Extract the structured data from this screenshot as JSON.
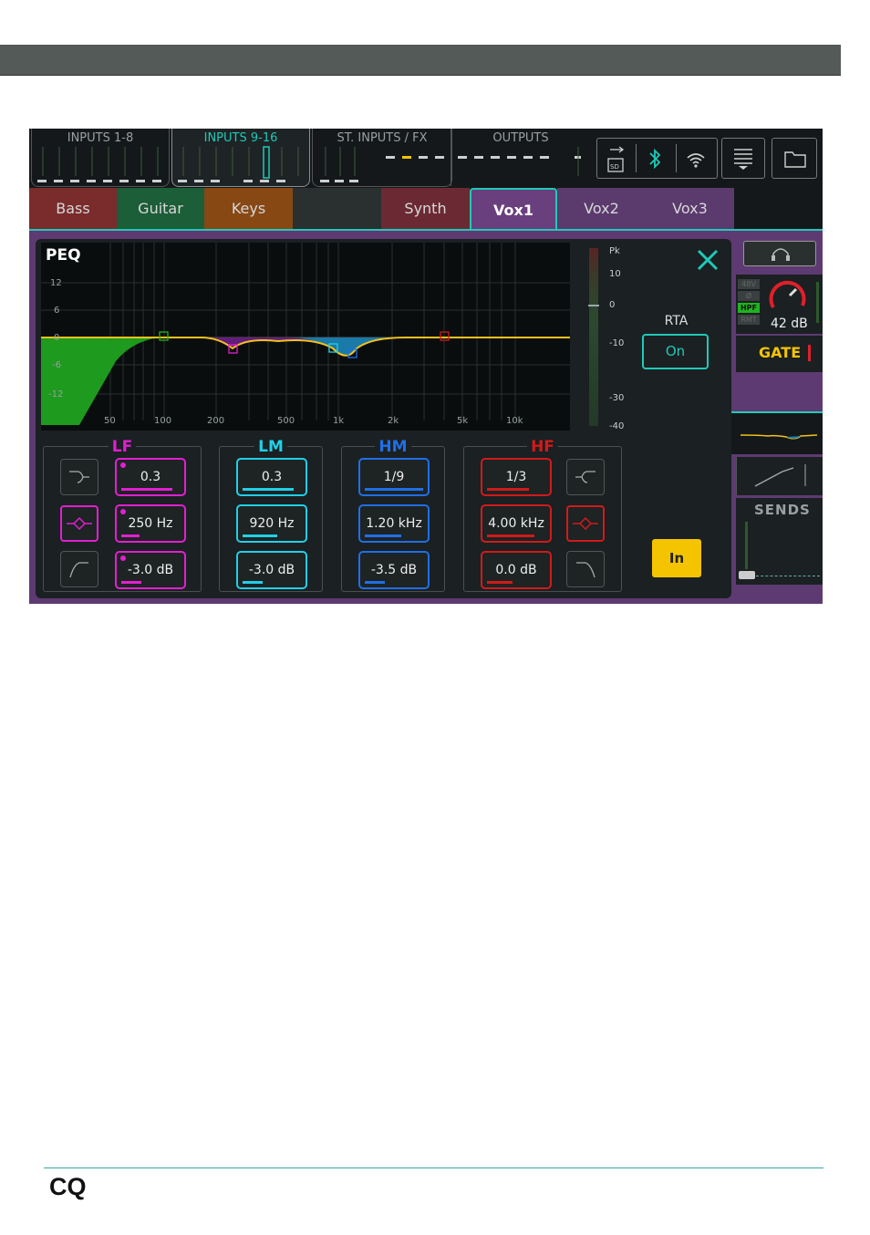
{
  "nav_groups": [
    {
      "label": "INPUTS 1-8",
      "active": false
    },
    {
      "label": "INPUTS 9-16",
      "active": true
    },
    {
      "label": "ST. INPUTS / FX",
      "active": false
    },
    {
      "label": "OUTPUTS",
      "active": false
    }
  ],
  "tabs": [
    {
      "label": "Bass",
      "color": "#7a2b2b",
      "active": false
    },
    {
      "label": "Guitar",
      "color": "#1c5e38",
      "active": false
    },
    {
      "label": "Keys",
      "color": "#874814",
      "active": false
    },
    {
      "label": "",
      "color": "#2a2f30",
      "active": false
    },
    {
      "label": "Synth",
      "color": "#6b2a33",
      "active": false
    },
    {
      "label": "Vox1",
      "color": "#6a3f7e",
      "active": true
    },
    {
      "label": "Vox2",
      "color": "#5b3a6e",
      "active": false
    },
    {
      "label": "Vox3",
      "color": "#5b3a6e",
      "active": false
    }
  ],
  "icons": {
    "usb_sd": "usb-sd-icon",
    "bluetooth": "bluetooth-icon",
    "wifi": "wifi-icon",
    "menu": "menu-icon",
    "folder": "folder-icon",
    "close": "close-icon",
    "headphones": "headphones-icon"
  },
  "peq": {
    "title": "PEQ",
    "y_ticks": [
      "12",
      "6",
      "0",
      "-6",
      "-12"
    ],
    "x_ticks": [
      "50",
      "100",
      "200",
      "500",
      "1k",
      "2k",
      "5k",
      "10k"
    ],
    "meter_ticks": [
      "Pk",
      "10",
      "0",
      "-10",
      "-30",
      "-40"
    ],
    "rta_label": "RTA",
    "rta_button": "On",
    "in_button": "In"
  },
  "bands": [
    {
      "name": "LF",
      "color": "#e21fd2",
      "width": "0.3",
      "freq": "250 Hz",
      "gain": "-3.0 dB"
    },
    {
      "name": "LM",
      "color": "#1fd0e8",
      "width": "0.3",
      "freq": "920 Hz",
      "gain": "-3.0 dB"
    },
    {
      "name": "HM",
      "color": "#1f6fe8",
      "width": "1/9",
      "freq": "1.20 kHz",
      "gain": "-3.5 dB"
    },
    {
      "name": "HF",
      "color": "#d21a1a",
      "width": "1/3",
      "freq": "4.00 kHz",
      "gain": "0.0 dB"
    }
  ],
  "side": {
    "preamp_flags": [
      "48V",
      "Ø",
      "HPF",
      "RMT"
    ],
    "gain_readout": "42 dB",
    "gate_label": "GATE",
    "sends_label": "SENDS"
  },
  "colors": {
    "accent": "#1fc9b8",
    "in_button": "#f5c400",
    "gate": "#f5c400",
    "panel_purple": "#6a3f7e"
  },
  "footer": {
    "logo": "CQ"
  }
}
